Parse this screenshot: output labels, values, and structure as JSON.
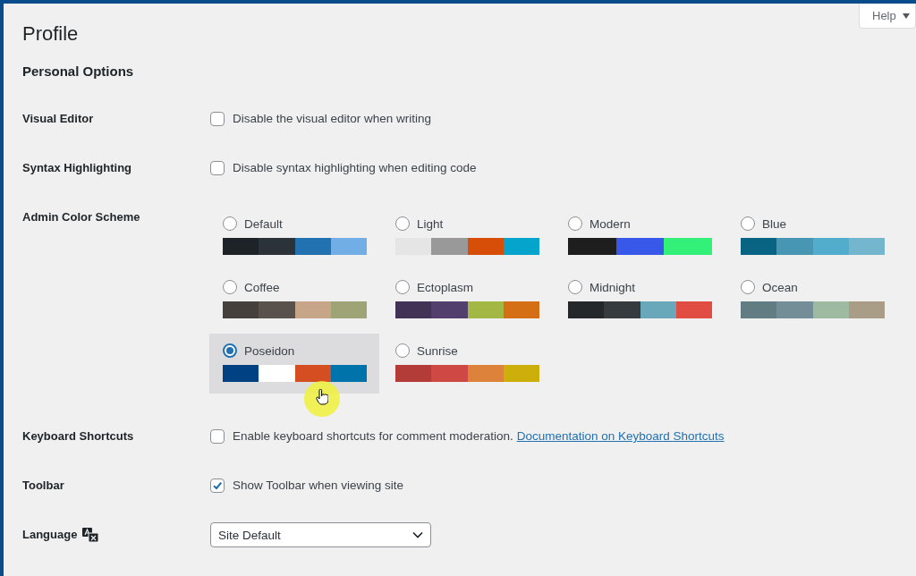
{
  "help_tab": {
    "label": "Help",
    "expanded": false
  },
  "title": "Profile",
  "section_title": "Personal Options",
  "rows": [
    {
      "kind": "checkbox",
      "label": "Visual Editor",
      "text": "Disable the visual editor when writing",
      "checked": false
    },
    {
      "kind": "checkbox",
      "label": "Syntax Highlighting",
      "text": "Disable syntax highlighting when editing code",
      "checked": false
    },
    {
      "kind": "schemes",
      "label": "Admin Color Scheme",
      "schemes": [
        {
          "name": "Default",
          "selected": false,
          "swatches": [
            {
              "color": "#1d2327"
            },
            {
              "color": "#2c3338"
            },
            {
              "color": "#2271b1"
            },
            {
              "color": "#72aee6"
            }
          ]
        },
        {
          "name": "Light",
          "selected": false,
          "swatches": [
            {
              "color": "#e5e5e5"
            },
            {
              "color": "#999999"
            },
            {
              "color": "#d64e07"
            },
            {
              "color": "#04a4cc"
            }
          ]
        },
        {
          "name": "Modern",
          "selected": false,
          "swatches": [
            {
              "color": "#1e1e1e"
            },
            {
              "color": "#3858e9"
            },
            {
              "color": "#33f078"
            }
          ]
        },
        {
          "name": "Blue",
          "selected": false,
          "swatches": [
            {
              "color": "#096484"
            },
            {
              "color": "#4796b3"
            },
            {
              "color": "#52accc"
            },
            {
              "color": "#74b6ce"
            }
          ]
        },
        {
          "name": "Coffee",
          "selected": false,
          "swatches": [
            {
              "color": "#46403c"
            },
            {
              "color": "#59524c"
            },
            {
              "color": "#c7a589"
            },
            {
              "color": "#9ea476"
            }
          ]
        },
        {
          "name": "Ectoplasm",
          "selected": false,
          "swatches": [
            {
              "color": "#413256"
            },
            {
              "color": "#523f6d"
            },
            {
              "color": "#a3b745"
            },
            {
              "color": "#d46f15"
            }
          ]
        },
        {
          "name": "Midnight",
          "selected": false,
          "swatches": [
            {
              "color": "#25282b"
            },
            {
              "color": "#363b3f"
            },
            {
              "color": "#69a8bb"
            },
            {
              "color": "#e14d43"
            }
          ]
        },
        {
          "name": "Ocean",
          "selected": false,
          "swatches": [
            {
              "color": "#627c83"
            },
            {
              "color": "#738e96"
            },
            {
              "color": "#9ebaa0"
            },
            {
              "color": "#aa9d88"
            }
          ]
        },
        {
          "name": "Poseidon",
          "selected": true,
          "swatches": [
            {
              "color": "#004184"
            },
            {
              "color": "#ffffff"
            },
            {
              "color": "#d54e21"
            },
            {
              "color": "#0073aa"
            }
          ]
        },
        {
          "name": "Sunrise",
          "selected": false,
          "swatches": [
            {
              "color": "#b43c38"
            },
            {
              "color": "#cf4944"
            },
            {
              "color": "#dd823b"
            },
            {
              "color": "#ccaf0b"
            }
          ]
        }
      ]
    },
    {
      "kind": "checkbox",
      "label": "Keyboard Shortcuts",
      "text": "Enable keyboard shortcuts for comment moderation.",
      "link": "Documentation on Keyboard Shortcuts",
      "checked": false
    },
    {
      "kind": "checkbox",
      "label": "Toolbar",
      "text": "Show Toolbar when viewing site",
      "checked": true
    },
    {
      "kind": "select",
      "label": "Language",
      "value": "Site Default"
    }
  ]
}
